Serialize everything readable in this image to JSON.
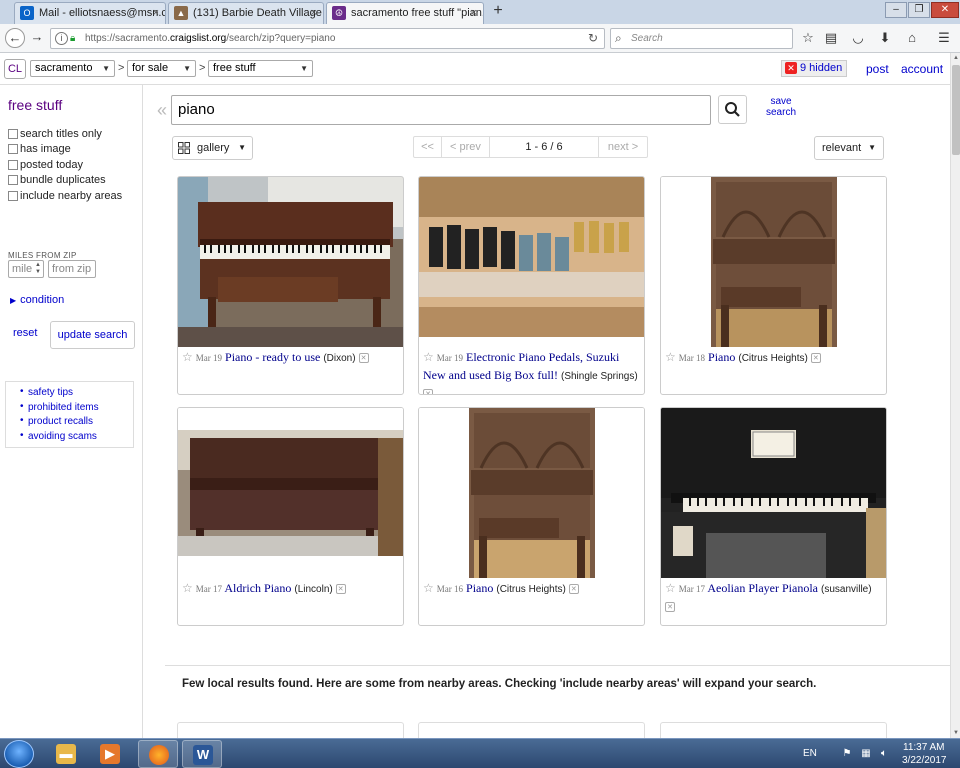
{
  "browser": {
    "tabs": [
      {
        "label": "Mail - elliotsnaess@msn.c...",
        "close": "×"
      },
      {
        "label": "(131) Barbie Death Village r...",
        "close": "×"
      },
      {
        "label": "sacramento free stuff \"pian...",
        "close": "×"
      }
    ],
    "new_tab": "+",
    "url_prefix": "https://sacramento.",
    "url_domain": "craigslist.org",
    "url_path": "/search/zip?query=piano",
    "search_placeholder": "Search"
  },
  "header": {
    "logo": "CL",
    "area": "sacramento",
    "section": "for sale",
    "category": "free stuff",
    "sep1": ">",
    "sep2": ">",
    "hidden_count": "9 hidden",
    "post": "post",
    "account": "account"
  },
  "sidebar": {
    "title": "free stuff",
    "options": [
      "search titles only",
      "has image",
      "posted today",
      "bundle duplicates",
      "include nearby areas"
    ],
    "miles_label": "MILES FROM ZIP",
    "miles_placeholder": "mile",
    "zip_placeholder": "from zip",
    "condition": "condition",
    "reset": "reset",
    "update": "update search",
    "links": [
      "safety tips",
      "prohibited items",
      "product recalls",
      "avoiding scams"
    ]
  },
  "search": {
    "query": "piano",
    "save_search": "save search",
    "view": "gallery",
    "sort": "relevant",
    "pager": {
      "first": "<<",
      "prev": "< prev",
      "range": "1 - 6 / 6",
      "next": "next >"
    }
  },
  "results": [
    {
      "date": "Mar 19",
      "title": "Piano - ready to use",
      "hood": "(Dixon)"
    },
    {
      "date": "Mar 19",
      "title": "Electronic Piano Pedals, Suzuki New and used Big Box full!",
      "hood": "(Shingle Springs)"
    },
    {
      "date": "Mar 18",
      "title": "Piano",
      "hood": "(Citrus Heights)"
    },
    {
      "date": "Mar 17",
      "title": "Aldrich Piano",
      "hood": "(Lincoln)"
    },
    {
      "date": "Mar 16",
      "title": "Piano",
      "hood": "(Citrus Heights)"
    },
    {
      "date": "Mar 17",
      "title": "Aeolian Player Pianola",
      "hood": "(susanville)"
    }
  ],
  "nearby_message": "Few local results found. Here are some from nearby areas. Checking 'include nearby areas' will expand your search.",
  "taskbar": {
    "lang": "EN",
    "time": "11:37 AM",
    "date": "3/22/2017"
  }
}
